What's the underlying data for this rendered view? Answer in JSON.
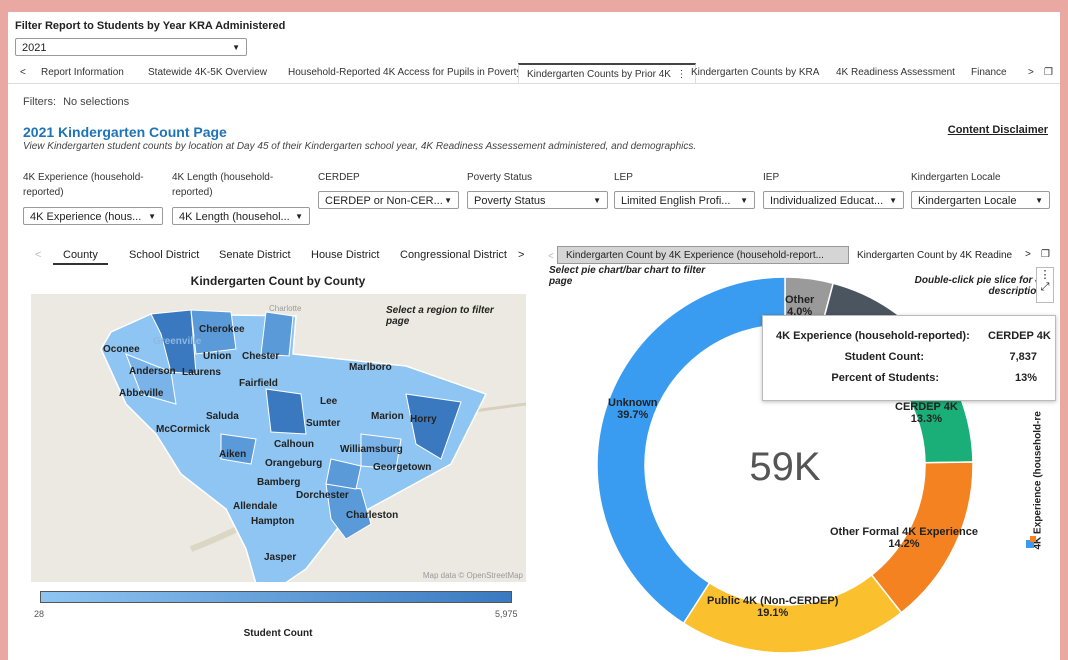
{
  "filter_section": {
    "label": "Filter Report to Students by Year KRA Administered",
    "year_value": "2021"
  },
  "tabs": [
    {
      "label": "Report Information"
    },
    {
      "label": "Statewide 4K-5K Overview"
    },
    {
      "label": "Household-Reported 4K Access for Pupils in Poverty"
    },
    {
      "label": "Kindergarten Counts by Prior 4K"
    },
    {
      "label": "Kindergarten Counts by KRA"
    },
    {
      "label": "4K Readiness Assessment"
    },
    {
      "label": "Finance"
    }
  ],
  "filters_text": "Filters:",
  "filters_value": "No selections",
  "page": {
    "title": "2021 Kindergarten Count Page",
    "subtitle": "View Kindergarten student counts by location at Day 45 of their Kindergarten school year, 4K Readiness Assessement administered, and demographics.",
    "disclaimer": "Content Disclaimer"
  },
  "dropdowns": [
    {
      "label": "4K Experience (household-reported)",
      "value": "4K Experience (hous..."
    },
    {
      "label": "4K Length (household-reported)",
      "value": "4K Length (househol..."
    },
    {
      "label": "CERDEP",
      "value": "CERDEP or Non-CER..."
    },
    {
      "label": "Poverty Status",
      "value": "Poverty Status"
    },
    {
      "label": "LEP",
      "value": "Limited English Profi..."
    },
    {
      "label": "IEP",
      "value": "Individualized Educat..."
    },
    {
      "label": "Kindergarten Locale",
      "value": "Kindergarten Locale"
    }
  ],
  "subtabs": [
    {
      "label": "County"
    },
    {
      "label": "School District"
    },
    {
      "label": "Senate District"
    },
    {
      "label": "House District"
    },
    {
      "label": "Congressional District"
    }
  ],
  "right_tabs": [
    {
      "label": "Kindergarten Count by 4K Experience (household-report..."
    },
    {
      "label": "Kindergarten Count by 4K Readine"
    }
  ],
  "map": {
    "title": "Kindergarten Count by County",
    "hint": "Select a region to filter page",
    "credit": "Map data © OpenStreetMap",
    "counties": [
      "Cherokee",
      "Greenville",
      "Oconee",
      "Anderson",
      "Laurens",
      "Union",
      "Chester",
      "Marlboro",
      "Abbeville",
      "Fairfield",
      "Lee",
      "Saluda",
      "Sumter",
      "Marion",
      "Horry",
      "McCormick",
      "Calhoun",
      "Aiken",
      "Williamsburg",
      "Orangeburg",
      "Georgetown",
      "Bamberg",
      "Dorchester",
      "Charleston",
      "Allendale",
      "Hampton",
      "Jasper"
    ],
    "faint_labels": [
      "Charlotte"
    ],
    "legend_min": "28",
    "legend_max": "5,975",
    "legend_title": "Student Count",
    "colors": {
      "light": "#8ec5f2",
      "mid": "#5a9ad8",
      "dark": "#3a79c0"
    }
  },
  "pie": {
    "hint_left": "Select pie chart/bar chart to filter page",
    "hint_right": "Double-click pie slice for 4K descriptions",
    "center_value": "59K",
    "side_label": "4K Experience (household-re"
  },
  "chart_data": {
    "type": "pie",
    "title": "",
    "center_label": "59K",
    "slices": [
      {
        "label": "Other",
        "percent": 4.0,
        "color": "#9a9a9a"
      },
      {
        "label": "",
        "percent": 6.7,
        "color": "#4a5560"
      },
      {
        "label": "CERDEP 4K",
        "percent": 13.3,
        "color": "#1aae79"
      },
      {
        "label": "Other Formal 4K Experience",
        "percent": 14.2,
        "color": "#f58220"
      },
      {
        "label": "Public 4K (Non-CERDEP)",
        "percent": 19.1,
        "color": "#fbc02d"
      },
      {
        "label": "Unknown",
        "percent": 39.7,
        "color": "#3a9cf0"
      }
    ]
  },
  "tooltip": {
    "row1_label": "4K Experience (household-reported):",
    "row1_value": "CERDEP 4K",
    "row2_label": "Student Count:",
    "row2_value": "7,837",
    "row3_label": "Percent of Students:",
    "row3_value": "13%"
  }
}
